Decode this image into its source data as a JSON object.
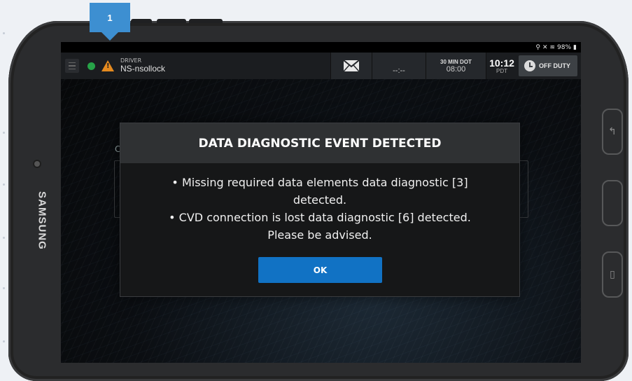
{
  "step_badge": "1",
  "device_brand": "SAMSUNG",
  "statusbar": {
    "battery": "98%"
  },
  "appbar": {
    "driver_label": "DRIVER",
    "driver_name": "NS-nsollock",
    "message_placeholder": "--:--",
    "dot_label": "30 MIN DOT",
    "dot_time": "08:00",
    "clock_time": "10:12",
    "clock_tz": "PDT",
    "duty_status": "OFF DUTY",
    "colors": {
      "status_green": "#27a348",
      "warning_orange": "#e58a1f"
    }
  },
  "background_form": {
    "label_partial": "C"
  },
  "dialog": {
    "title": "DATA DIAGNOSTIC EVENT DETECTED",
    "line1": "• Missing required data elements data diagnostic [3]",
    "line2": "detected.",
    "line3": "• CVD connection is lost data diagnostic [6] detected.",
    "line4": "Please be advised.",
    "ok_label": "OK",
    "accent": "#1172c4"
  },
  "icons": [
    "menu-icon",
    "status-dot-icon",
    "warning-icon",
    "envelope-icon",
    "clock-icon",
    "location-icon",
    "mute-icon",
    "wifi-icon",
    "battery-icon",
    "back-key-icon",
    "home-key-icon",
    "recents-key-icon",
    "front-camera-icon"
  ]
}
